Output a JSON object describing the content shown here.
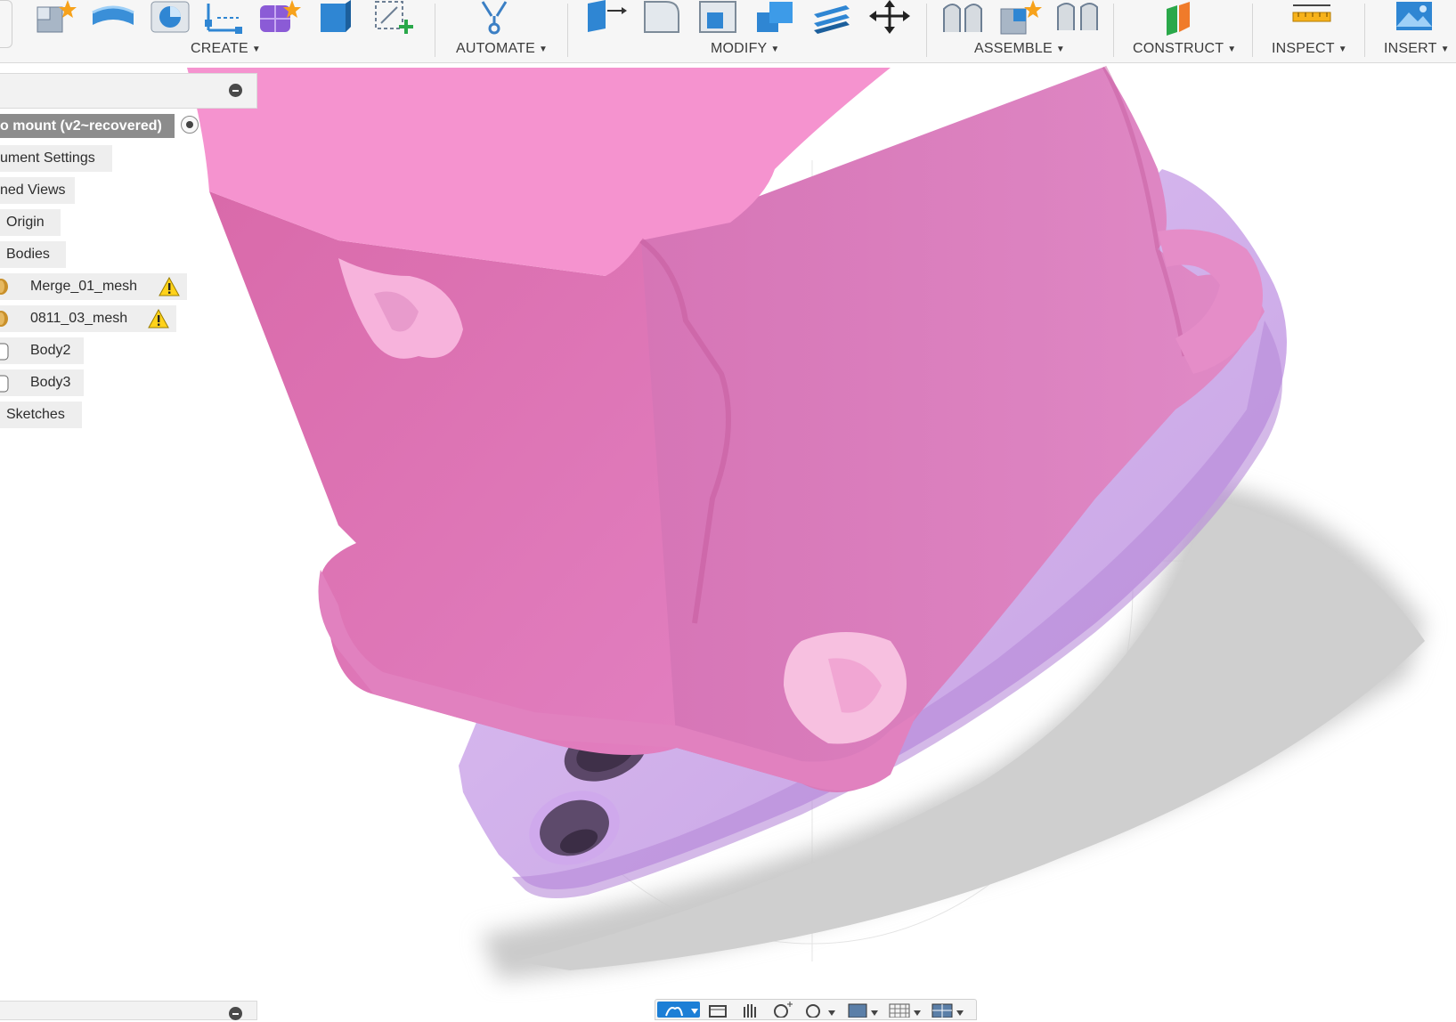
{
  "toolbar": {
    "groups": [
      {
        "label": "CREATE"
      },
      {
        "label": "AUTOMATE"
      },
      {
        "label": "MODIFY"
      },
      {
        "label": "ASSEMBLE"
      },
      {
        "label": "CONSTRUCT"
      },
      {
        "label": "INSPECT"
      },
      {
        "label": "INSERT"
      }
    ],
    "icons": {
      "create": [
        "new-component-icon",
        "extrude-icon",
        "revolve-icon",
        "sketch-dimension-icon",
        "form-icon",
        "box-icon",
        "create-sketch-icon"
      ],
      "automate": [
        "automate-icon"
      ],
      "modify": [
        "press-pull-icon",
        "fillet-icon",
        "shell-icon",
        "combine-icon",
        "offset-face-icon",
        "move-icon"
      ],
      "assemble": [
        "joint-icon",
        "new-component-assemble-icon",
        "as-built-joint-icon"
      ],
      "construct": [
        "construct-plane-icon"
      ],
      "inspect": [
        "measure-icon"
      ],
      "insert": [
        "insert-image-icon"
      ]
    }
  },
  "browser": {
    "root": "o mount (v2~recovered)",
    "items": [
      {
        "label": "ument Settings"
      },
      {
        "label": "ned Views"
      },
      {
        "label": "Origin"
      },
      {
        "label": "Bodies"
      },
      {
        "label": "Merge_01_mesh",
        "warning": true
      },
      {
        "label": "0811_03_mesh",
        "warning": true
      },
      {
        "label": "Body2"
      },
      {
        "label": "Body3"
      },
      {
        "label": "Sketches"
      }
    ]
  },
  "navbar": {
    "items": [
      "orbit-icon",
      "look-at-icon",
      "pan-icon",
      "zoom-icon",
      "fit-icon",
      "display-settings-icon",
      "grid-icon",
      "viewports-icon"
    ]
  },
  "colors": {
    "pink_mesh": "#e07ab8",
    "pink_top": "#f592cf",
    "lilac_mesh": "#d2b0ea",
    "shadow": "#cfcfcf",
    "accent": "#1c7fd6"
  }
}
